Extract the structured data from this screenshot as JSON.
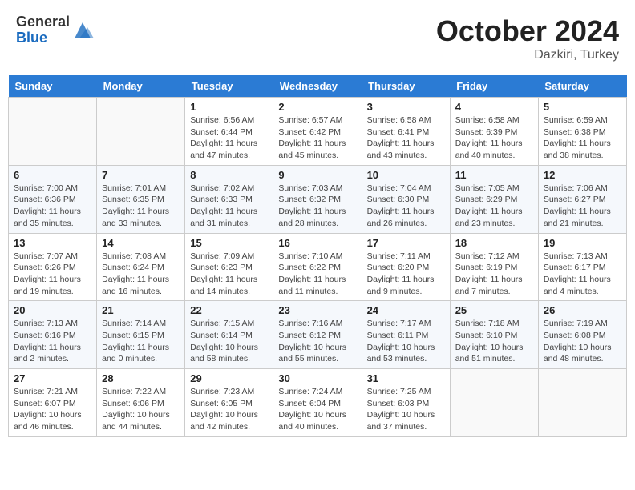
{
  "header": {
    "logo_general": "General",
    "logo_blue": "Blue",
    "month_title": "October 2024",
    "location": "Dazkiri, Turkey"
  },
  "days_of_week": [
    "Sunday",
    "Monday",
    "Tuesday",
    "Wednesday",
    "Thursday",
    "Friday",
    "Saturday"
  ],
  "weeks": [
    [
      {
        "day": "",
        "sunrise": "",
        "sunset": "",
        "daylight": "",
        "empty": true
      },
      {
        "day": "",
        "sunrise": "",
        "sunset": "",
        "daylight": "",
        "empty": true
      },
      {
        "day": "1",
        "sunrise": "Sunrise: 6:56 AM",
        "sunset": "Sunset: 6:44 PM",
        "daylight": "Daylight: 11 hours and 47 minutes.",
        "empty": false
      },
      {
        "day": "2",
        "sunrise": "Sunrise: 6:57 AM",
        "sunset": "Sunset: 6:42 PM",
        "daylight": "Daylight: 11 hours and 45 minutes.",
        "empty": false
      },
      {
        "day": "3",
        "sunrise": "Sunrise: 6:58 AM",
        "sunset": "Sunset: 6:41 PM",
        "daylight": "Daylight: 11 hours and 43 minutes.",
        "empty": false
      },
      {
        "day": "4",
        "sunrise": "Sunrise: 6:58 AM",
        "sunset": "Sunset: 6:39 PM",
        "daylight": "Daylight: 11 hours and 40 minutes.",
        "empty": false
      },
      {
        "day": "5",
        "sunrise": "Sunrise: 6:59 AM",
        "sunset": "Sunset: 6:38 PM",
        "daylight": "Daylight: 11 hours and 38 minutes.",
        "empty": false
      }
    ],
    [
      {
        "day": "6",
        "sunrise": "Sunrise: 7:00 AM",
        "sunset": "Sunset: 6:36 PM",
        "daylight": "Daylight: 11 hours and 35 minutes.",
        "empty": false
      },
      {
        "day": "7",
        "sunrise": "Sunrise: 7:01 AM",
        "sunset": "Sunset: 6:35 PM",
        "daylight": "Daylight: 11 hours and 33 minutes.",
        "empty": false
      },
      {
        "day": "8",
        "sunrise": "Sunrise: 7:02 AM",
        "sunset": "Sunset: 6:33 PM",
        "daylight": "Daylight: 11 hours and 31 minutes.",
        "empty": false
      },
      {
        "day": "9",
        "sunrise": "Sunrise: 7:03 AM",
        "sunset": "Sunset: 6:32 PM",
        "daylight": "Daylight: 11 hours and 28 minutes.",
        "empty": false
      },
      {
        "day": "10",
        "sunrise": "Sunrise: 7:04 AM",
        "sunset": "Sunset: 6:30 PM",
        "daylight": "Daylight: 11 hours and 26 minutes.",
        "empty": false
      },
      {
        "day": "11",
        "sunrise": "Sunrise: 7:05 AM",
        "sunset": "Sunset: 6:29 PM",
        "daylight": "Daylight: 11 hours and 23 minutes.",
        "empty": false
      },
      {
        "day": "12",
        "sunrise": "Sunrise: 7:06 AM",
        "sunset": "Sunset: 6:27 PM",
        "daylight": "Daylight: 11 hours and 21 minutes.",
        "empty": false
      }
    ],
    [
      {
        "day": "13",
        "sunrise": "Sunrise: 7:07 AM",
        "sunset": "Sunset: 6:26 PM",
        "daylight": "Daylight: 11 hours and 19 minutes.",
        "empty": false
      },
      {
        "day": "14",
        "sunrise": "Sunrise: 7:08 AM",
        "sunset": "Sunset: 6:24 PM",
        "daylight": "Daylight: 11 hours and 16 minutes.",
        "empty": false
      },
      {
        "day": "15",
        "sunrise": "Sunrise: 7:09 AM",
        "sunset": "Sunset: 6:23 PM",
        "daylight": "Daylight: 11 hours and 14 minutes.",
        "empty": false
      },
      {
        "day": "16",
        "sunrise": "Sunrise: 7:10 AM",
        "sunset": "Sunset: 6:22 PM",
        "daylight": "Daylight: 11 hours and 11 minutes.",
        "empty": false
      },
      {
        "day": "17",
        "sunrise": "Sunrise: 7:11 AM",
        "sunset": "Sunset: 6:20 PM",
        "daylight": "Daylight: 11 hours and 9 minutes.",
        "empty": false
      },
      {
        "day": "18",
        "sunrise": "Sunrise: 7:12 AM",
        "sunset": "Sunset: 6:19 PM",
        "daylight": "Daylight: 11 hours and 7 minutes.",
        "empty": false
      },
      {
        "day": "19",
        "sunrise": "Sunrise: 7:13 AM",
        "sunset": "Sunset: 6:17 PM",
        "daylight": "Daylight: 11 hours and 4 minutes.",
        "empty": false
      }
    ],
    [
      {
        "day": "20",
        "sunrise": "Sunrise: 7:13 AM",
        "sunset": "Sunset: 6:16 PM",
        "daylight": "Daylight: 11 hours and 2 minutes.",
        "empty": false
      },
      {
        "day": "21",
        "sunrise": "Sunrise: 7:14 AM",
        "sunset": "Sunset: 6:15 PM",
        "daylight": "Daylight: 11 hours and 0 minutes.",
        "empty": false
      },
      {
        "day": "22",
        "sunrise": "Sunrise: 7:15 AM",
        "sunset": "Sunset: 6:14 PM",
        "daylight": "Daylight: 10 hours and 58 minutes.",
        "empty": false
      },
      {
        "day": "23",
        "sunrise": "Sunrise: 7:16 AM",
        "sunset": "Sunset: 6:12 PM",
        "daylight": "Daylight: 10 hours and 55 minutes.",
        "empty": false
      },
      {
        "day": "24",
        "sunrise": "Sunrise: 7:17 AM",
        "sunset": "Sunset: 6:11 PM",
        "daylight": "Daylight: 10 hours and 53 minutes.",
        "empty": false
      },
      {
        "day": "25",
        "sunrise": "Sunrise: 7:18 AM",
        "sunset": "Sunset: 6:10 PM",
        "daylight": "Daylight: 10 hours and 51 minutes.",
        "empty": false
      },
      {
        "day": "26",
        "sunrise": "Sunrise: 7:19 AM",
        "sunset": "Sunset: 6:08 PM",
        "daylight": "Daylight: 10 hours and 48 minutes.",
        "empty": false
      }
    ],
    [
      {
        "day": "27",
        "sunrise": "Sunrise: 7:21 AM",
        "sunset": "Sunset: 6:07 PM",
        "daylight": "Daylight: 10 hours and 46 minutes.",
        "empty": false
      },
      {
        "day": "28",
        "sunrise": "Sunrise: 7:22 AM",
        "sunset": "Sunset: 6:06 PM",
        "daylight": "Daylight: 10 hours and 44 minutes.",
        "empty": false
      },
      {
        "day": "29",
        "sunrise": "Sunrise: 7:23 AM",
        "sunset": "Sunset: 6:05 PM",
        "daylight": "Daylight: 10 hours and 42 minutes.",
        "empty": false
      },
      {
        "day": "30",
        "sunrise": "Sunrise: 7:24 AM",
        "sunset": "Sunset: 6:04 PM",
        "daylight": "Daylight: 10 hours and 40 minutes.",
        "empty": false
      },
      {
        "day": "31",
        "sunrise": "Sunrise: 7:25 AM",
        "sunset": "Sunset: 6:03 PM",
        "daylight": "Daylight: 10 hours and 37 minutes.",
        "empty": false
      },
      {
        "day": "",
        "sunrise": "",
        "sunset": "",
        "daylight": "",
        "empty": true
      },
      {
        "day": "",
        "sunrise": "",
        "sunset": "",
        "daylight": "",
        "empty": true
      }
    ]
  ]
}
